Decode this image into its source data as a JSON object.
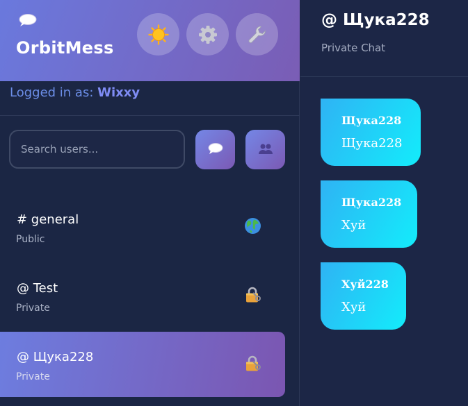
{
  "app": {
    "title": "OrbitMess",
    "logo_icon": "speech-balloon-icon",
    "header_buttons": [
      {
        "name": "theme-toggle-button",
        "icon": "sun-icon"
      },
      {
        "name": "settings-button",
        "icon": "gear-icon"
      },
      {
        "name": "tools-button",
        "icon": "wrench-icon"
      }
    ]
  },
  "user": {
    "logged_label": "Logged in as:",
    "username": "Wixxy"
  },
  "search": {
    "placeholder": "Search users..."
  },
  "actions": [
    {
      "name": "new-chat-button",
      "icon": "speech-balloon-icon"
    },
    {
      "name": "new-group-button",
      "icon": "group-icon"
    }
  ],
  "chats": [
    {
      "name": "# general",
      "type": "Public",
      "icon": "globe-icon",
      "active": false
    },
    {
      "name": "@ Test",
      "type": "Private",
      "icon": "lock-icon",
      "active": false
    },
    {
      "name": "@ Щука228",
      "type": "Private",
      "icon": "lock-icon",
      "active": true
    }
  ],
  "conversation": {
    "title": "@ Щука228",
    "subtitle": "Private Chat",
    "messages": [
      {
        "author": "Щука228",
        "text": "Щука228"
      },
      {
        "author": "Щука228",
        "text": "Хуй"
      },
      {
        "author": "Хуй228",
        "text": "Хуй"
      }
    ]
  },
  "colors": {
    "background": "#1b2544",
    "header_gradient_start": "#6a79dd",
    "header_gradient_end": "#7a5db5",
    "username_accent": "#7f8cf5",
    "bubble_gradient_start": "#2fb3f4",
    "bubble_gradient_end": "#13ecfb"
  }
}
